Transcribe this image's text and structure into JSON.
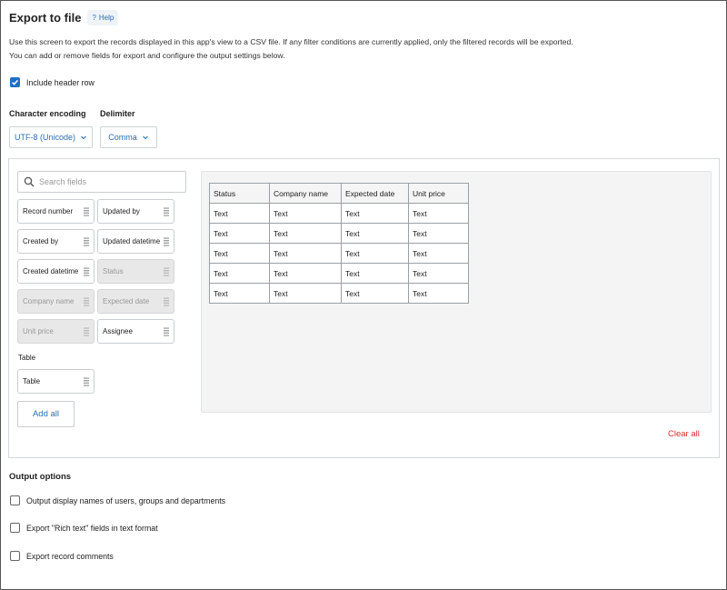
{
  "header": {
    "title": "Export to file",
    "help_label": "Help"
  },
  "description": {
    "line1": "Use this screen to export the records displayed in this app's view to a CSV file. If any filter conditions are currently applied, only the filtered records will be exported.",
    "line2": "You can add or remove fields for export and configure the output settings below."
  },
  "include_header": {
    "label": "Include header row",
    "checked": true
  },
  "encoding": {
    "label": "Character encoding",
    "value": "UTF-8 (Unicode)"
  },
  "delimiter": {
    "label": "Delimiter",
    "value": "Comma"
  },
  "search": {
    "placeholder": "Search fields"
  },
  "fields": [
    {
      "label": "Record number",
      "disabled": false
    },
    {
      "label": "Updated by",
      "disabled": false
    },
    {
      "label": "Created by",
      "disabled": false
    },
    {
      "label": "Updated datetime",
      "disabled": false
    },
    {
      "label": "Created datetime",
      "disabled": false
    },
    {
      "label": "Status",
      "disabled": true
    },
    {
      "label": "Company name",
      "disabled": true
    },
    {
      "label": "Expected date",
      "disabled": true
    },
    {
      "label": "Unit price",
      "disabled": true
    },
    {
      "label": "Assignee",
      "disabled": false
    }
  ],
  "table_section": {
    "label": "Table",
    "field_label": "Table"
  },
  "add_all_label": "Add all",
  "preview": {
    "columns": [
      "Status",
      "Company name",
      "Expected date",
      "Unit price"
    ],
    "rows": [
      [
        "Text",
        "Text",
        "Text",
        "Text"
      ],
      [
        "Text",
        "Text",
        "Text",
        "Text"
      ],
      [
        "Text",
        "Text",
        "Text",
        "Text"
      ],
      [
        "Text",
        "Text",
        "Text",
        "Text"
      ],
      [
        "Text",
        "Text",
        "Text",
        "Text"
      ]
    ]
  },
  "clear_all_label": "Clear all",
  "output_options": {
    "title": "Output options",
    "options": [
      {
        "label": "Output display names of users, groups and departments",
        "checked": false
      },
      {
        "label": "Export \"Rich text\" fields in text format",
        "checked": false
      },
      {
        "label": "Export record comments",
        "checked": false
      }
    ]
  },
  "colors": {
    "link_blue": "#2a6fb5",
    "check_blue": "#1f6fc5",
    "clear_red": "#d32f2f",
    "disabled_bg": "#e8e8e8"
  }
}
